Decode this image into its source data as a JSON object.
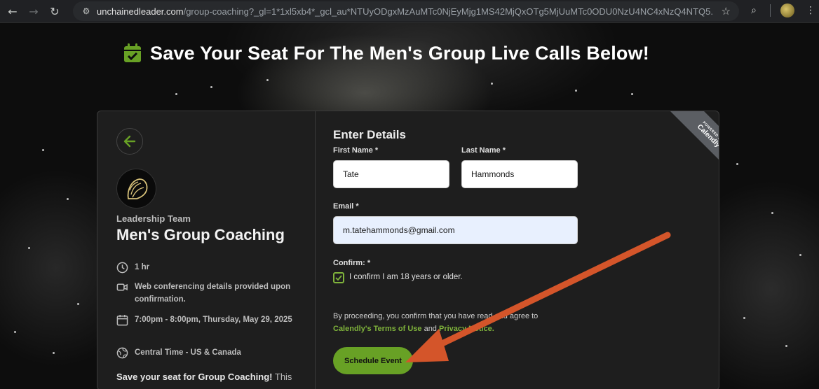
{
  "browser": {
    "url_domain": "unchainedleader.com",
    "url_path": "/group-coaching?_gl=1*1xl5xb4*_gcl_au*NTUyODgxMzAuMTc0NjEyMjg1MS42MjQxOTg5MjUuMTc0ODU0NzU4NC4xNzQ4NTQ5..."
  },
  "page": {
    "heading": "Save Your Seat For The Men's Group Live Calls Below!"
  },
  "event": {
    "organizer": "Leadership Team",
    "title": "Men's Group Coaching",
    "duration": "1 hr",
    "conferencing": "Web conferencing details provided upon confirmation.",
    "datetime": "7:00pm - 8:00pm, Thursday, May 29, 2025",
    "timezone": "Central Time - US & Canada",
    "promo_bold": "Save your seat for Group Coaching!",
    "promo_rest": " This"
  },
  "form": {
    "title": "Enter Details",
    "first_name_label": "First Name *",
    "first_name_value": "Tate",
    "last_name_label": "Last Name *",
    "last_name_value": "Hammonds",
    "email_label": "Email *",
    "email_value": "m.tatehammonds@gmail.com",
    "confirm_label": "Confirm: *",
    "confirm_option": "I confirm I am 18 years or older.",
    "confirm_checked": true,
    "legal_prefix": "By proceeding, you confirm that you have read and agree to",
    "terms_link": "Calendly's Terms of Use",
    "legal_and": " and ",
    "privacy_link": "Privacy Notice.",
    "submit_label": "Schedule Event"
  },
  "ribbon": {
    "small": "POWERED BY",
    "brand": "Calendly"
  },
  "colors": {
    "accent": "#68a125",
    "link": "#7fb33b",
    "annotation_arrow": "#d4552a"
  }
}
